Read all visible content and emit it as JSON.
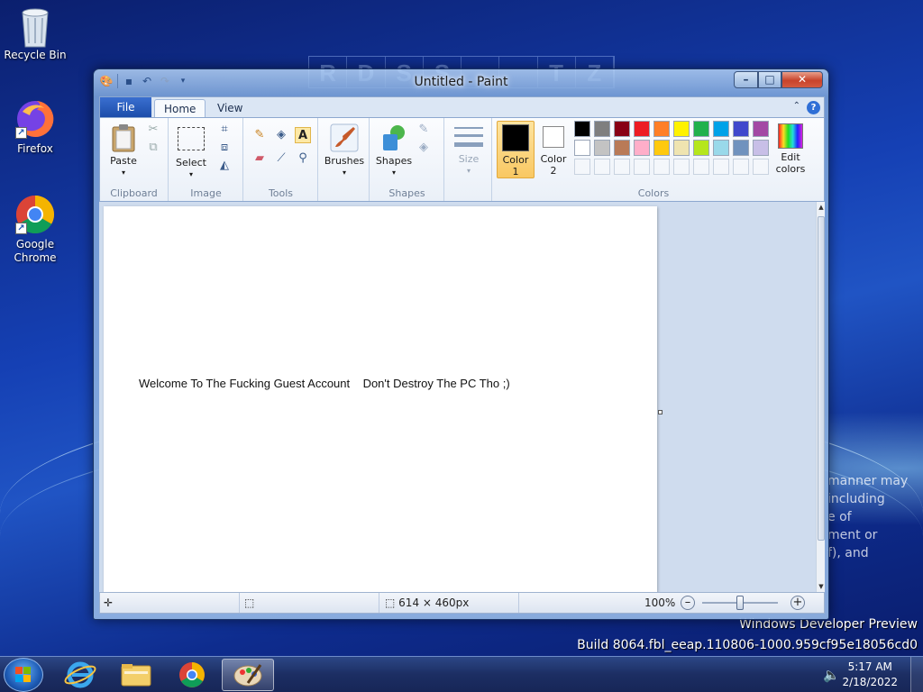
{
  "desktop": {
    "icons": [
      {
        "label": "Recycle Bin",
        "icon": "recycle-bin-icon"
      },
      {
        "label": "Firefox",
        "icon": "firefox-icon"
      },
      {
        "label": "Google Chrome",
        "icon": "chrome-icon"
      }
    ],
    "background_letters": [
      "R",
      "D",
      "S",
      "S",
      "",
      "",
      "T",
      "Z"
    ],
    "side_text_lines": [
      "manner may",
      "including",
      "e of",
      "ment or",
      "f), and"
    ],
    "watermark": {
      "line1": "Windows Developer Preview",
      "line2": "Build 8064.fbl_eeap.110806-1000.959cf95e18056cd0"
    }
  },
  "window": {
    "title": "Untitled - Paint",
    "qat_icons": [
      "paint-app-icon",
      "save-icon",
      "undo-icon",
      "redo-icon",
      "customize-qat-icon"
    ],
    "controls": {
      "minimize": "minimize-icon",
      "maximize": "maximize-icon",
      "close": "close-icon"
    }
  },
  "ribbon": {
    "file_tab": "File",
    "tabs": [
      {
        "label": "Home",
        "active": true
      },
      {
        "label": "View",
        "active": false
      }
    ],
    "groups": {
      "clipboard": {
        "label": "Clipboard",
        "paste": "Paste"
      },
      "image": {
        "label": "Image",
        "select": "Select"
      },
      "tools": {
        "label": "Tools"
      },
      "brushes": {
        "label": "Brushes"
      },
      "shapes": {
        "label": "Shapes",
        "shapes_button": "Shapes"
      },
      "size": {
        "label": "Size"
      },
      "colors": {
        "label": "Colors",
        "color1_line1": "Color",
        "color1_line2": "1",
        "color2_line1": "Color",
        "color2_line2": "2",
        "edit_line1": "Edit",
        "edit_line2": "colors",
        "color1_value": "#000000",
        "color2_value": "#ffffff",
        "palette_row1": [
          "#000000",
          "#7f7f7f",
          "#880015",
          "#ed1c24",
          "#ff7f27",
          "#fff200",
          "#22b14c",
          "#00a2e8",
          "#3f48cc",
          "#a349a4"
        ],
        "palette_row2": [
          "#ffffff",
          "#c3c3c3",
          "#b97a57",
          "#ffaec9",
          "#ffc90e",
          "#efe4b0",
          "#b5e61d",
          "#99d9ea",
          "#7092be",
          "#c8bfe7"
        ],
        "palette_row3_empty_count": 10
      }
    }
  },
  "canvas": {
    "text": "Welcome To The Fucking Guest Account    Don't Destroy The PC Tho ;)"
  },
  "statusbar": {
    "dimensions": "614 × 460px",
    "zoom": "100%",
    "zoom_level_fraction": 0.5
  },
  "taskbar": {
    "items": [
      {
        "name": "internet-explorer-icon",
        "active": false
      },
      {
        "name": "file-explorer-icon",
        "active": false
      },
      {
        "name": "chrome-icon",
        "active": false
      },
      {
        "name": "paint-icon",
        "active": true
      }
    ],
    "time": "5:17 AM",
    "date": "2/18/2022"
  }
}
